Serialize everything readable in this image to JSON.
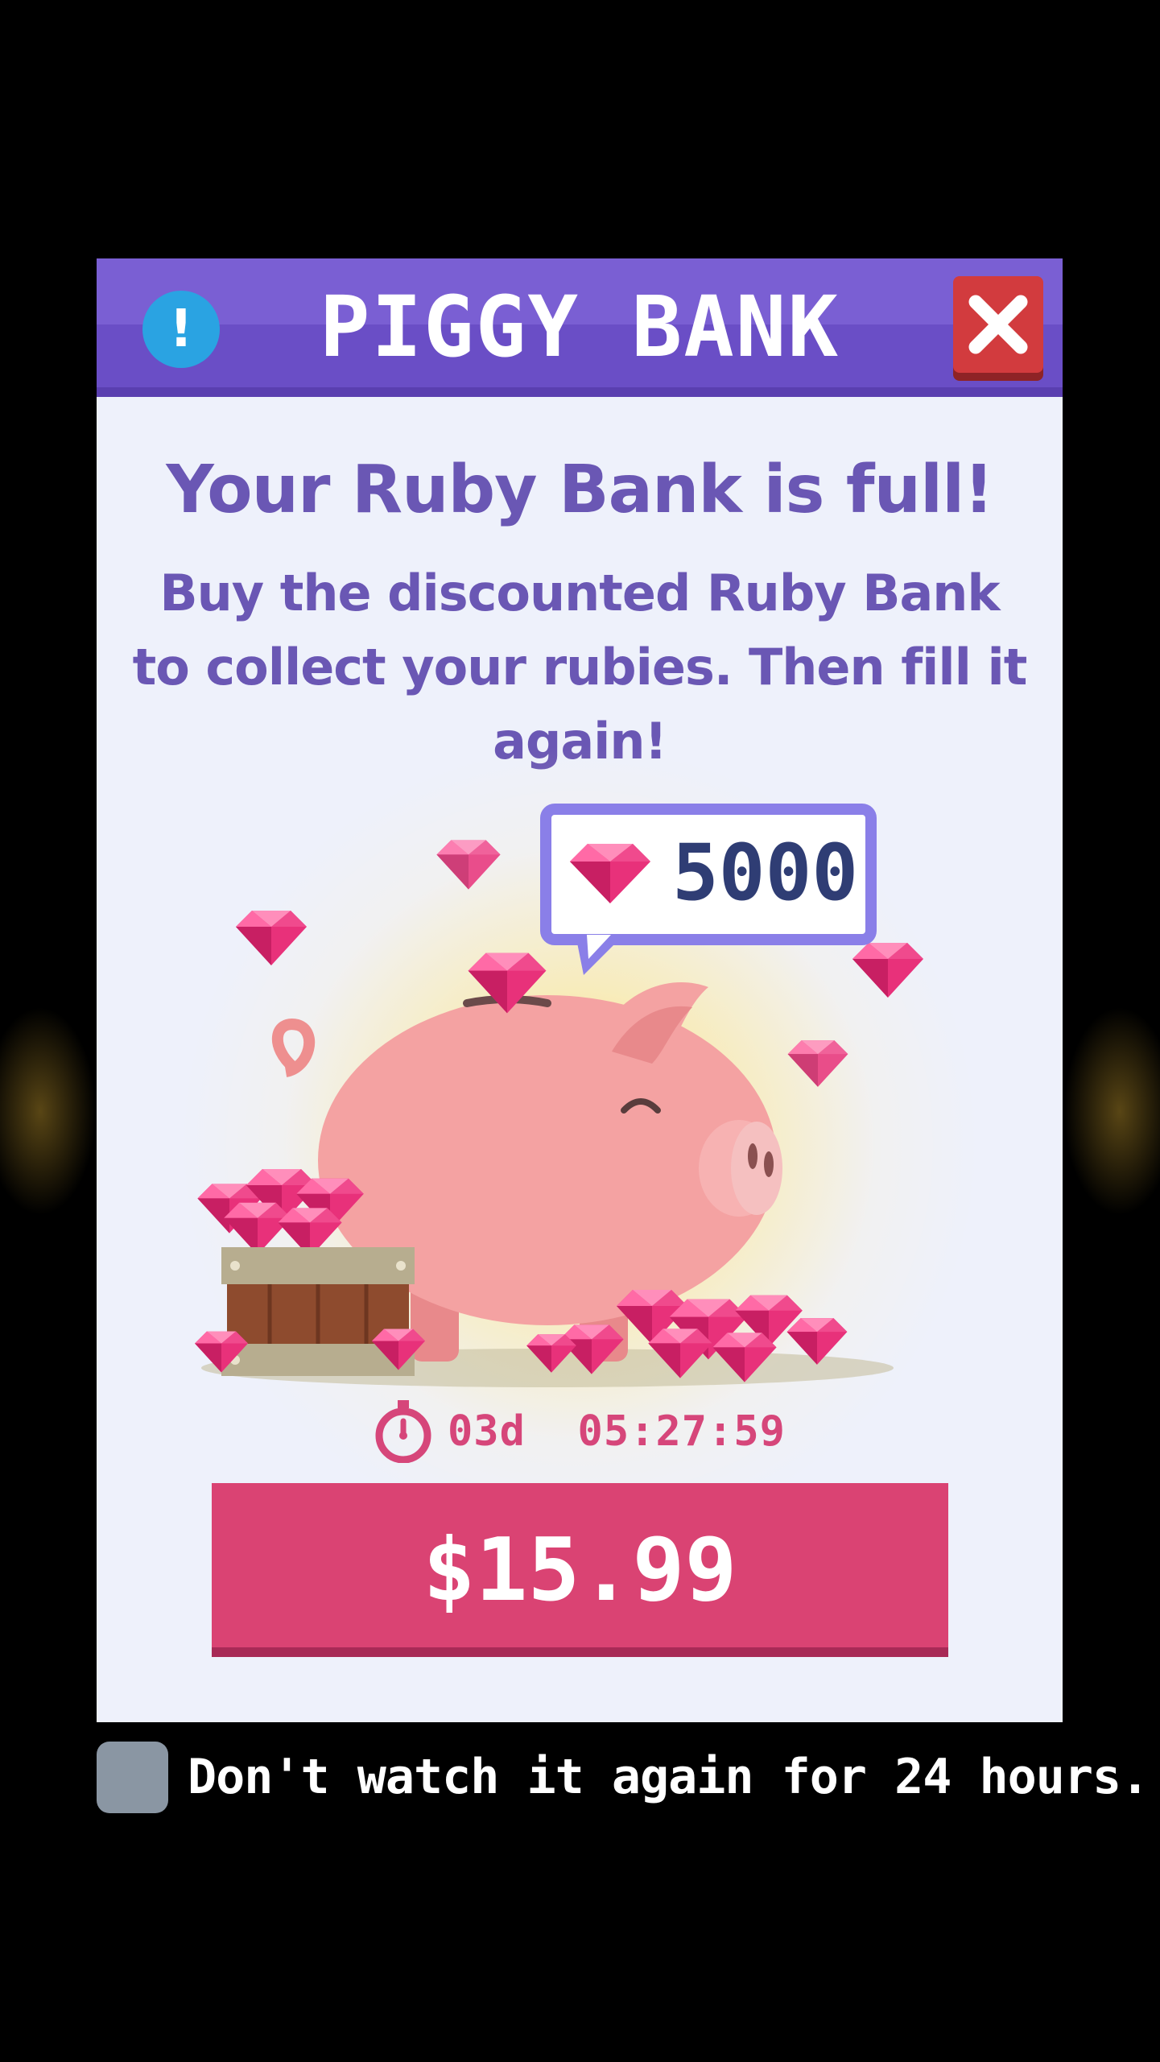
{
  "header": {
    "title": "PIGGY BANK",
    "info_icon": "exclamation-icon",
    "info_label": "!",
    "close_icon": "close-icon"
  },
  "content": {
    "headline": "Your Ruby Bank is full!",
    "subtitle": "Buy the discounted Ruby Bank to collect your rubies. Then fill it again!"
  },
  "bank": {
    "ruby_amount": "5000",
    "gem_icon": "ruby-icon"
  },
  "timer": {
    "icon": "stopwatch-icon",
    "text": "03d  05:27:59"
  },
  "purchase": {
    "price": "$15.99"
  },
  "footer": {
    "dont_show_label": "Don't watch it again for 24 hours."
  },
  "colors": {
    "header": "#6a4ec6",
    "accent_pink": "#da4373",
    "text_purple": "#6a57b4",
    "close_red": "#d23b3e",
    "info_blue": "#2aa3e2"
  }
}
